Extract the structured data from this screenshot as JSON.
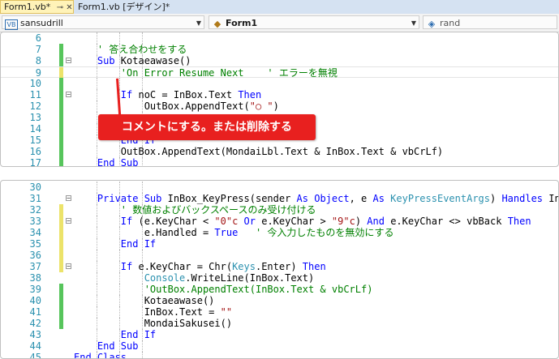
{
  "tabs": [
    {
      "label": "Form1.vb*",
      "active": true
    },
    {
      "label": "Form1.vb [デザイン]*",
      "active": false
    }
  ],
  "tab_icons": "⊸ ✕",
  "navbar": {
    "project": {
      "icon": "VB",
      "label": "sansudrill"
    },
    "class": {
      "label": "Form1"
    },
    "member": {
      "label": "rand"
    }
  },
  "callout": "コメントにする。または削除する",
  "colors": {
    "accent": "#e8201f",
    "keyword": "#0000ff",
    "comment": "#008000",
    "string": "#a31515",
    "type": "#2b91af",
    "linenumber": "#2b91af"
  },
  "panel1": {
    "lines": [
      {
        "num": "6",
        "chg": "",
        "fold": "",
        "html_parts": [
          {
            "c": "",
            "t": ""
          }
        ]
      },
      {
        "num": "7",
        "chg": "g",
        "fold": "",
        "html_parts": [
          {
            "c": "cm",
            "t": "    ' 答え合わせをする"
          }
        ]
      },
      {
        "num": "8",
        "chg": "g",
        "fold": "−",
        "html_parts": [
          {
            "c": "kw",
            "t": "    Sub "
          },
          {
            "c": "",
            "t": "Kotaeawase()"
          }
        ]
      },
      {
        "num": "9",
        "chg": "y",
        "fold": "",
        "html_parts": [
          {
            "c": "cm",
            "t": "        'On Error Resume Next    ' エラーを無視"
          }
        ]
      },
      {
        "num": "10",
        "chg": "g",
        "fold": "",
        "html_parts": [
          {
            "c": "",
            "t": ""
          }
        ]
      },
      {
        "num": "11",
        "chg": "g",
        "fold": "−",
        "html_parts": [
          {
            "c": "kw",
            "t": "        If "
          },
          {
            "c": "",
            "t": "noC = InBox.Text "
          },
          {
            "c": "kw",
            "t": "Then"
          }
        ]
      },
      {
        "num": "12",
        "chg": "g",
        "fold": "",
        "html_parts": [
          {
            "c": "",
            "t": "            OutBox.AppendText("
          },
          {
            "c": "st",
            "t": "\"○ \""
          },
          {
            "c": "",
            "t": ")"
          }
        ]
      },
      {
        "num": "13",
        "chg": "g",
        "fold": "",
        "html_parts": [
          {
            "c": "",
            "t": ""
          }
        ]
      },
      {
        "num": "14",
        "chg": "g",
        "fold": "",
        "html_parts": [
          {
            "c": "",
            "t": ""
          }
        ]
      },
      {
        "num": "15",
        "chg": "g",
        "fold": "",
        "html_parts": [
          {
            "c": "kw",
            "t": "        End If"
          }
        ]
      },
      {
        "num": "16",
        "chg": "g",
        "fold": "",
        "html_parts": [
          {
            "c": "",
            "t": "        OutBox.AppendText(MondaiLbl.Text & InBox.Text & vbCrLf)"
          }
        ]
      },
      {
        "num": "17",
        "chg": "g",
        "fold": "",
        "html_parts": [
          {
            "c": "kw",
            "t": "    End Sub"
          }
        ]
      }
    ]
  },
  "panel2": {
    "lines": [
      {
        "num": "30",
        "chg": "",
        "fold": "",
        "html_parts": [
          {
            "c": "",
            "t": ""
          }
        ]
      },
      {
        "num": "31",
        "chg": "",
        "fold": "−",
        "html_parts": [
          {
            "c": "kw",
            "t": "    Private Sub "
          },
          {
            "c": "",
            "t": "InBox_KeyPress(sender "
          },
          {
            "c": "kw",
            "t": "As Object"
          },
          {
            "c": "",
            "t": ", e "
          },
          {
            "c": "kw",
            "t": "As "
          },
          {
            "c": "ty",
            "t": "KeyPressEventArgs"
          },
          {
            "c": "",
            "t": ") "
          },
          {
            "c": "kw",
            "t": "Handles "
          },
          {
            "c": "",
            "t": "InBox"
          }
        ]
      },
      {
        "num": "32",
        "chg": "y",
        "fold": "",
        "html_parts": [
          {
            "c": "cm",
            "t": "        ' 数値およびバックスペースのみ受け付ける"
          }
        ]
      },
      {
        "num": "33",
        "chg": "y",
        "fold": "−",
        "html_parts": [
          {
            "c": "kw",
            "t": "        If "
          },
          {
            "c": "",
            "t": "(e.KeyChar < "
          },
          {
            "c": "st",
            "t": "\"0\"c"
          },
          {
            "c": "kw",
            "t": " Or "
          },
          {
            "c": "",
            "t": "e.KeyChar > "
          },
          {
            "c": "st",
            "t": "\"9\"c"
          },
          {
            "c": "",
            "t": ") "
          },
          {
            "c": "kw",
            "t": "And "
          },
          {
            "c": "",
            "t": "e.KeyChar <> vbBack "
          },
          {
            "c": "kw",
            "t": "Then"
          }
        ]
      },
      {
        "num": "34",
        "chg": "y",
        "fold": "",
        "html_parts": [
          {
            "c": "",
            "t": "            e.Handled = "
          },
          {
            "c": "kw",
            "t": "True"
          },
          {
            "c": "cm",
            "t": "   ' 今入力したものを無効にする"
          }
        ]
      },
      {
        "num": "35",
        "chg": "y",
        "fold": "",
        "html_parts": [
          {
            "c": "kw",
            "t": "        End If"
          }
        ]
      },
      {
        "num": "36",
        "chg": "y",
        "fold": "",
        "html_parts": [
          {
            "c": "",
            "t": ""
          }
        ]
      },
      {
        "num": "37",
        "chg": "y",
        "fold": "−",
        "html_parts": [
          {
            "c": "kw",
            "t": "        If "
          },
          {
            "c": "",
            "t": "e.KeyChar = Chr("
          },
          {
            "c": "ty",
            "t": "Keys"
          },
          {
            "c": "",
            "t": ".Enter) "
          },
          {
            "c": "kw",
            "t": "Then"
          }
        ]
      },
      {
        "num": "38",
        "chg": "",
        "fold": "",
        "html_parts": [
          {
            "c": "ty",
            "t": "            Console"
          },
          {
            "c": "",
            "t": ".WriteLine(InBox.Text)"
          }
        ]
      },
      {
        "num": "39",
        "chg": "g",
        "fold": "",
        "html_parts": [
          {
            "c": "cm",
            "t": "            'OutBox.AppendText(InBox.Text & vbCrLf)"
          }
        ]
      },
      {
        "num": "40",
        "chg": "g",
        "fold": "",
        "html_parts": [
          {
            "c": "",
            "t": "            Kotaeawase()"
          }
        ]
      },
      {
        "num": "41",
        "chg": "g",
        "fold": "",
        "html_parts": [
          {
            "c": "",
            "t": "            InBox.Text = "
          },
          {
            "c": "st",
            "t": "\"\""
          }
        ]
      },
      {
        "num": "42",
        "chg": "g",
        "fold": "",
        "html_parts": [
          {
            "c": "",
            "t": "            MondaiSakusei()"
          }
        ]
      },
      {
        "num": "43",
        "chg": "",
        "fold": "",
        "html_parts": [
          {
            "c": "kw",
            "t": "        End If"
          }
        ]
      },
      {
        "num": "44",
        "chg": "",
        "fold": "",
        "html_parts": [
          {
            "c": "kw",
            "t": "    End Sub"
          }
        ]
      },
      {
        "num": "45",
        "chg": "",
        "fold": "",
        "html_parts": [
          {
            "c": "kw",
            "t": "End Class"
          }
        ]
      }
    ]
  }
}
